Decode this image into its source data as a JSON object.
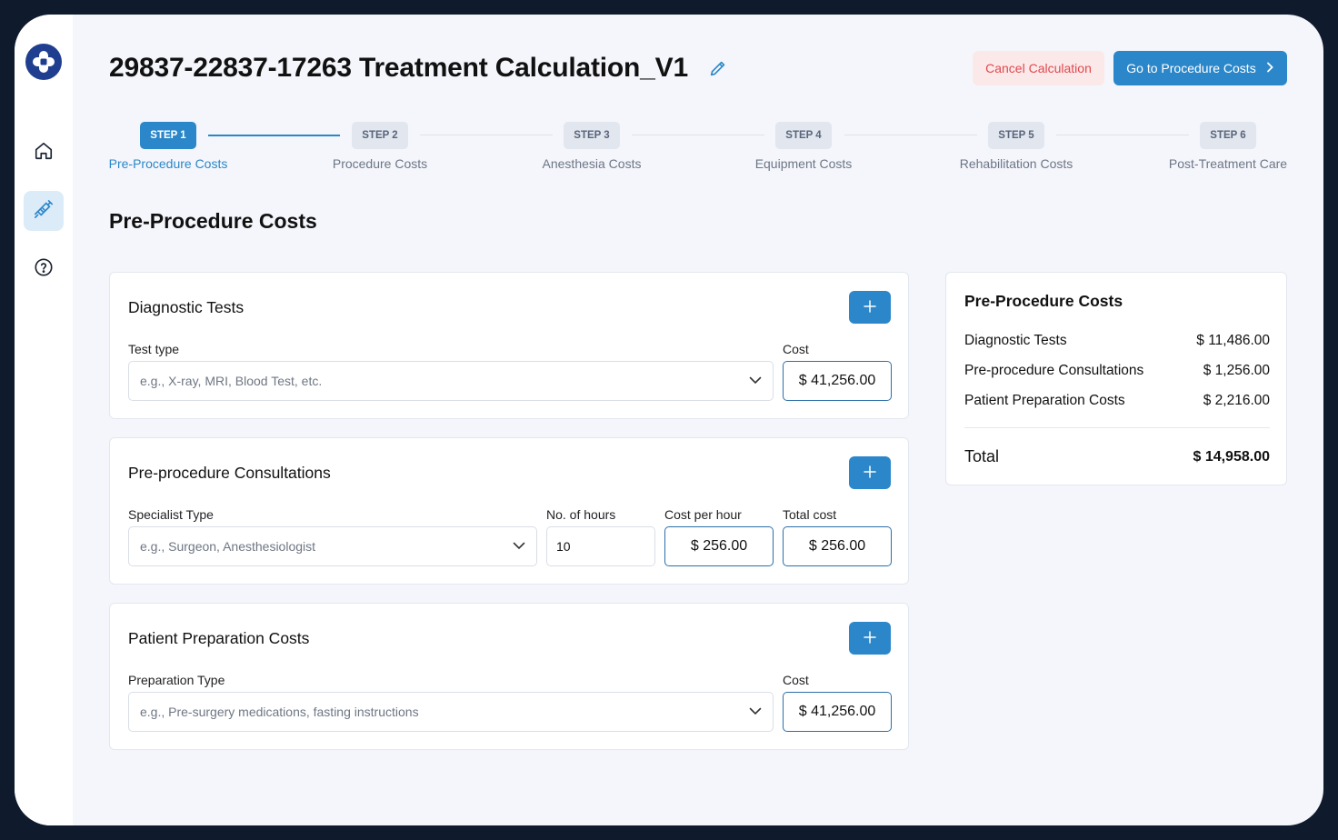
{
  "header": {
    "title": "29837-22837-17263 Treatment Calculation_V1",
    "cancel_label": "Cancel Calculation",
    "go_label": "Go to Procedure Costs"
  },
  "steps": [
    {
      "badge": "STEP 1",
      "label": "Pre-Procedure Costs",
      "active": true
    },
    {
      "badge": "STEP 2",
      "label": "Procedure Costs",
      "active": false
    },
    {
      "badge": "STEP 3",
      "label": "Anesthesia Costs",
      "active": false
    },
    {
      "badge": "STEP 4",
      "label": "Equipment Costs",
      "active": false
    },
    {
      "badge": "STEP 5",
      "label": "Rehabilitation Costs",
      "active": false
    },
    {
      "badge": "STEP 6",
      "label": "Post-Treatment Care",
      "active": false
    }
  ],
  "section_title": "Pre-Procedure Costs",
  "diagnostic": {
    "title": "Diagnostic Tests",
    "type_label": "Test type",
    "type_placeholder": "e.g., X-ray, MRI, Blood Test, etc.",
    "cost_label": "Cost",
    "cost_value": "$ 41,256.00"
  },
  "consultations": {
    "title": "Pre-procedure Consultations",
    "specialist_label": "Specialist Type",
    "specialist_placeholder": "e.g., Surgeon, Anesthesiologist",
    "hours_label": "No. of hours",
    "hours_value": "10",
    "rate_label": "Cost per hour",
    "rate_value": "$ 256.00",
    "total_label": "Total cost",
    "total_value": "$ 256.00"
  },
  "preparation": {
    "title": "Patient Preparation Costs",
    "type_label": "Preparation Type",
    "type_placeholder": "e.g., Pre-surgery medications, fasting instructions",
    "cost_label": "Cost",
    "cost_value": "$ 41,256.00"
  },
  "summary": {
    "title": "Pre-Procedure Costs",
    "rows": [
      {
        "label": "Diagnostic Tests",
        "value": "$ 11,486.00"
      },
      {
        "label": "Pre-procedure Consultations",
        "value": "$ 1,256.00"
      },
      {
        "label": "Patient Preparation Costs",
        "value": "$ 2,216.00"
      }
    ],
    "total_label": "Total",
    "total_value": "$ 14,958.00"
  },
  "colors": {
    "accent": "#2b87c9",
    "brand_navy": "#1f3e8f",
    "danger": "#e0484d",
    "danger_bg": "#fbe9ea"
  },
  "icons": {
    "logo": "medical-cross-icon",
    "nav": [
      "home-icon",
      "syringe-icon",
      "help-circle-icon"
    ],
    "edit": "pencil-icon",
    "add": "plus-icon",
    "dropdown": "chevron-down-icon",
    "next": "chevron-right-icon"
  }
}
